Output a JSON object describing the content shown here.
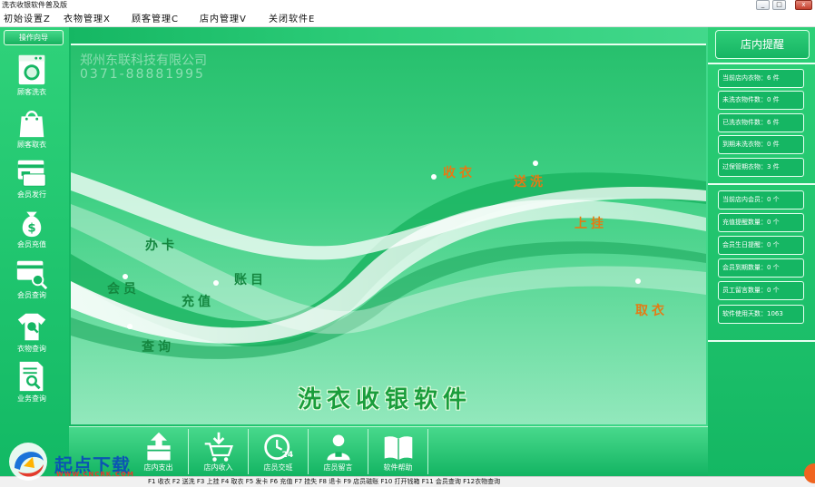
{
  "window": {
    "title": "洗衣收银软件普及版",
    "minimize": "_",
    "restore": "□",
    "close": "x"
  },
  "menu": {
    "items": [
      {
        "label": "初始设置Z"
      },
      {
        "label": "衣物管理X"
      },
      {
        "label": "顾客管理C"
      },
      {
        "label": "店内管理V"
      },
      {
        "label": "关闭软件E"
      }
    ]
  },
  "sidebar": {
    "guide_label": "操作向导",
    "items": [
      {
        "label": "顾客洗衣",
        "icon": "washing-machine-icon"
      },
      {
        "label": "顾客取衣",
        "icon": "shopping-bag-icon"
      },
      {
        "label": "会员发行",
        "icon": "member-card-icon"
      },
      {
        "label": "会员充值",
        "icon": "money-bag-icon"
      },
      {
        "label": "会员查询",
        "icon": "card-search-icon"
      },
      {
        "label": "衣物查询",
        "icon": "tshirt-search-icon"
      },
      {
        "label": "业务查询",
        "icon": "document-search-icon"
      }
    ]
  },
  "center": {
    "company": "郑州东联科技有限公司",
    "phone": "0371-88881995",
    "flow_left": [
      "办卡",
      "会员",
      "充值",
      "账目",
      "查询"
    ],
    "flow_right": [
      "收衣",
      "送洗",
      "上挂",
      "取衣"
    ],
    "app_name": "洗衣收银软件"
  },
  "toolbar": {
    "items": [
      {
        "label": "店内支出",
        "icon": "box-out-icon"
      },
      {
        "label": "店内收入",
        "icon": "cart-in-icon"
      },
      {
        "label": "店员交班",
        "icon": "clock-24-icon"
      },
      {
        "label": "店员留言",
        "icon": "person-message-icon"
      },
      {
        "label": "软件帮助",
        "icon": "book-help-icon"
      }
    ]
  },
  "right_panel": {
    "title": "店内提醒",
    "stats_group1": [
      {
        "label": "当前店内衣物：6 件"
      },
      {
        "label": "未洗衣物件数：0 件"
      },
      {
        "label": "已洗衣物件数：6 件"
      },
      {
        "label": "到期未洗衣物：0 件"
      },
      {
        "label": "过保管期衣物：3 件"
      }
    ],
    "stats_group2": [
      {
        "label": "当前店内会员：0 个"
      },
      {
        "label": "充值提醒数量：0 个"
      },
      {
        "label": "会员生日提醒：0 个"
      },
      {
        "label": "会员到期数量：0 个"
      },
      {
        "label": "员工留言数量：0 个"
      },
      {
        "label": "软件使用天数：1063"
      }
    ]
  },
  "statusbar": {
    "keys": "F1 收衣 F2 送洗 F3 上挂 F4 取衣 F5 发卡 F6 充值 F7 挂失 F8 退卡 F9 店员磁账 F10 打开钱箱 F11 会员查询 F12衣物查询"
  },
  "watermark": {
    "brand": "起点下载",
    "url": "WWW.CNCRK.COM"
  },
  "colors": {
    "primary_green": "#14b763",
    "accent_orange": "#e57a14",
    "title_green": "#1a9d3b"
  }
}
